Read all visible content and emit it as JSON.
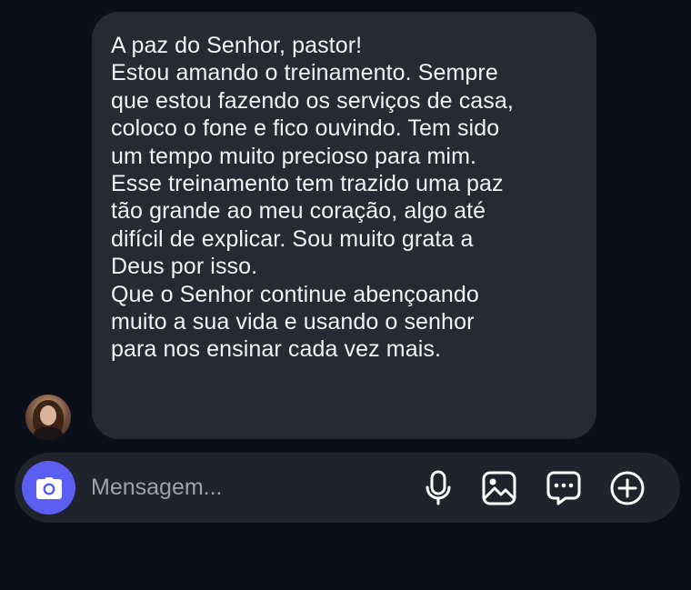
{
  "message": {
    "lines": [
      "A paz do Senhor, pastor!",
      "Estou amando o treinamento. Sempre",
      "que estou fazendo os serviços de casa,",
      "coloco o fone e fico ouvindo. Tem sido",
      "um tempo muito precioso para mim.",
      "Esse treinamento tem trazido uma paz",
      "tão grande ao meu coração, algo até",
      "difícil de explicar. Sou muito grata a",
      "Deus por isso.",
      "Que o Senhor continue abençoando",
      "muito a sua vida e usando o senhor",
      "para nos ensinar cada vez mais."
    ]
  },
  "composer": {
    "placeholder": "Mensagem...",
    "icons": {
      "camera": "camera-icon",
      "microphone": "microphone-icon",
      "gallery": "image-icon",
      "sticker": "chat-bubble-icon",
      "more": "plus-circle-icon"
    }
  },
  "colors": {
    "background": "#0b0f1a",
    "bubble": "#262a33",
    "composer": "#1f232b",
    "accent": "#5b5ef0",
    "text": "#f2f2f4",
    "placeholder": "#9ea2ab"
  }
}
